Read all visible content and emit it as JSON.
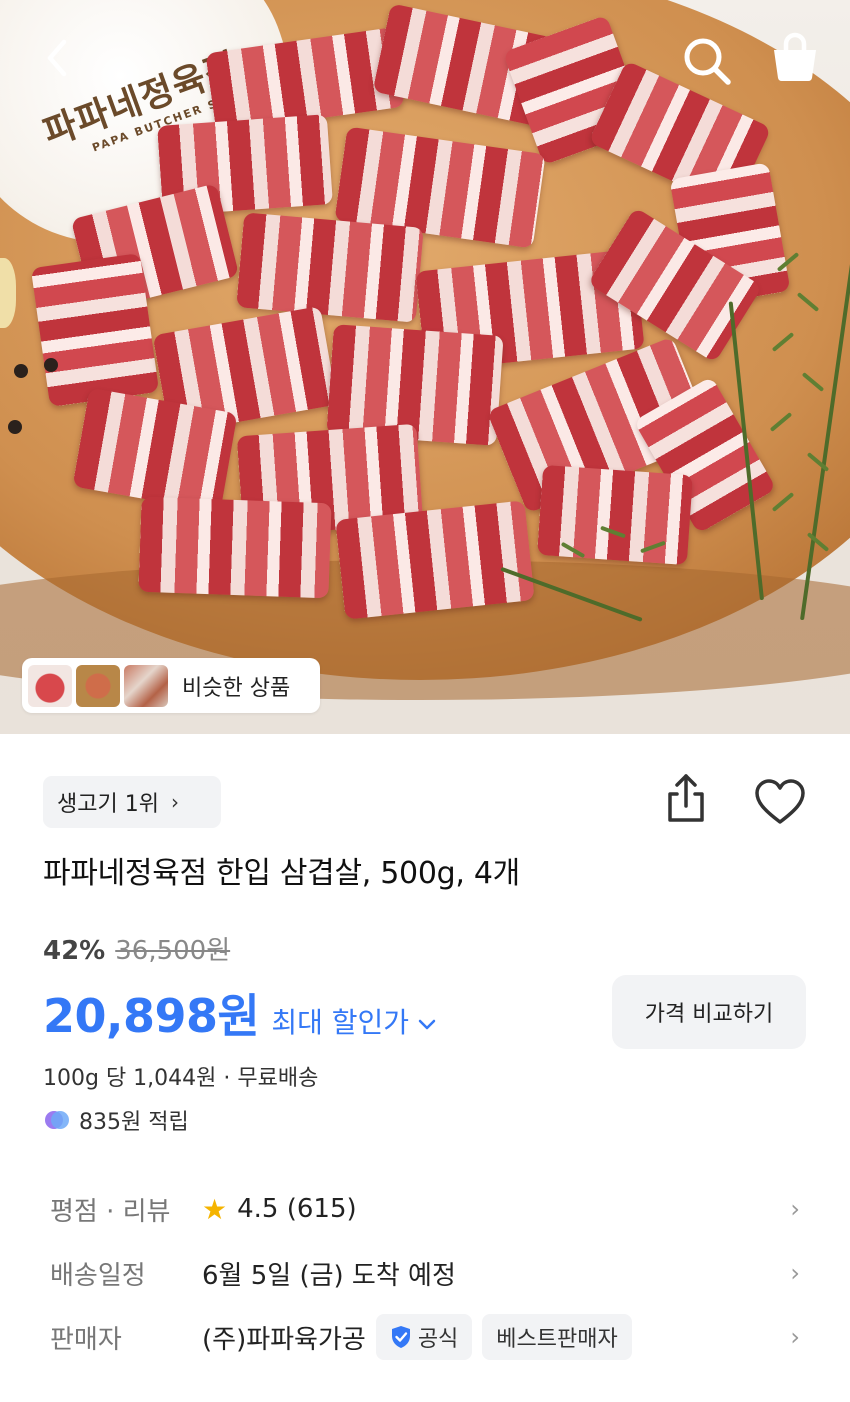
{
  "hero": {
    "stamp_brand_ko": "파파네정육점",
    "stamp_brand_en": "PAPA BUTCHER SHOP",
    "similar_label": "비슷한 상품"
  },
  "nav": {
    "back_icon": "chevron-left-icon",
    "search_icon": "search-icon",
    "cart_icon": "shopping-bag-icon"
  },
  "product": {
    "rank_label": "생고기 1위",
    "title": "파파네정육점 한입 삼겹살, 500g, 4개",
    "discount_percent": "42%",
    "original_price": "36,500원",
    "price": "20,898원",
    "max_discount_label": "최대 할인가",
    "compare_button": "가격 비교하기",
    "unit_price": "100g 당 1,044원 · 무료배송",
    "points": "835원 적립"
  },
  "details": {
    "rating_label": "평점 · 리뷰",
    "rating_value": "4.5 (615)",
    "delivery_label": "배송일정",
    "delivery_value": "6월 5일 (금) 도착 예정",
    "seller_label": "판매자",
    "seller_value": "(주)파파육가공",
    "official_tag": "공식",
    "best_seller_tag": "베스트판매자"
  },
  "colors": {
    "accent": "#3478f6",
    "star": "#f5b400",
    "chip_bg": "#f2f3f5"
  }
}
